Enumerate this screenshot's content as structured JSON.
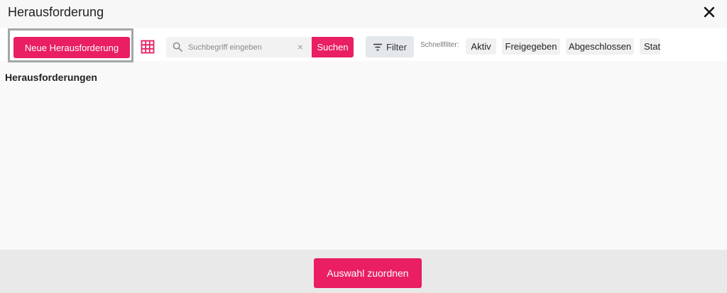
{
  "dialog": {
    "title": "Herausforderung"
  },
  "toolbar": {
    "new_button": "Neue Herausforderung",
    "search": {
      "placeholder": "Suchbegriff eingeben",
      "value": ""
    },
    "search_button": "Suchen",
    "filter_button": "Filter",
    "quick_filter_label": "Schnellfilter:",
    "quick_filters": [
      "Aktiv",
      "Freigegeben",
      "Abgeschlossen",
      "Stat"
    ]
  },
  "section": {
    "title": "Herausforderungen"
  },
  "footer": {
    "assign_button": "Auswahl zuordnen"
  },
  "colors": {
    "accent": "#e91e63",
    "highlight_border": "#a6a6a6",
    "filter_bg": "#e4e8ec"
  },
  "icons": [
    "close-icon",
    "grid-view-icon",
    "search-icon",
    "clear-icon",
    "filter-icon"
  ]
}
